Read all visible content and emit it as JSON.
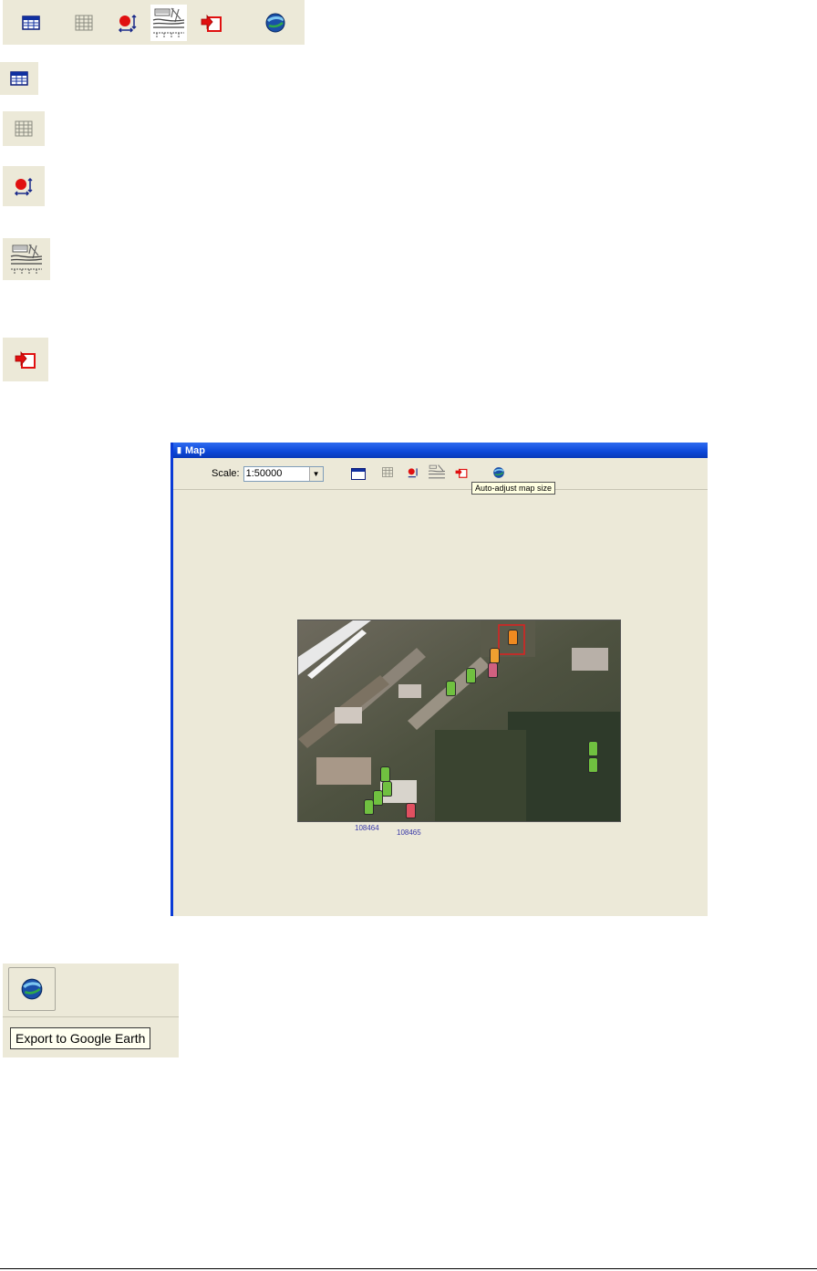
{
  "toolbar_icons": [
    {
      "name": "table-icon"
    },
    {
      "name": "grid-icon"
    },
    {
      "name": "point-resize-icon"
    },
    {
      "name": "street-map-icon"
    },
    {
      "name": "auto-adjust-icon"
    },
    {
      "name": "google-earth-icon"
    }
  ],
  "map_window": {
    "title": "Map",
    "scale_label": "Scale:",
    "scale_value": "1:50000",
    "tooltip": "Auto-adjust map size",
    "marker_labels": {
      "a": "108464",
      "b": "108465"
    }
  },
  "google_earth": {
    "tooltip": "Export to Google Earth"
  },
  "colors": {
    "xp_face": "#ece9d8",
    "xp_title": "#0b47d8",
    "tooltip_bg": "#ffffe1"
  }
}
